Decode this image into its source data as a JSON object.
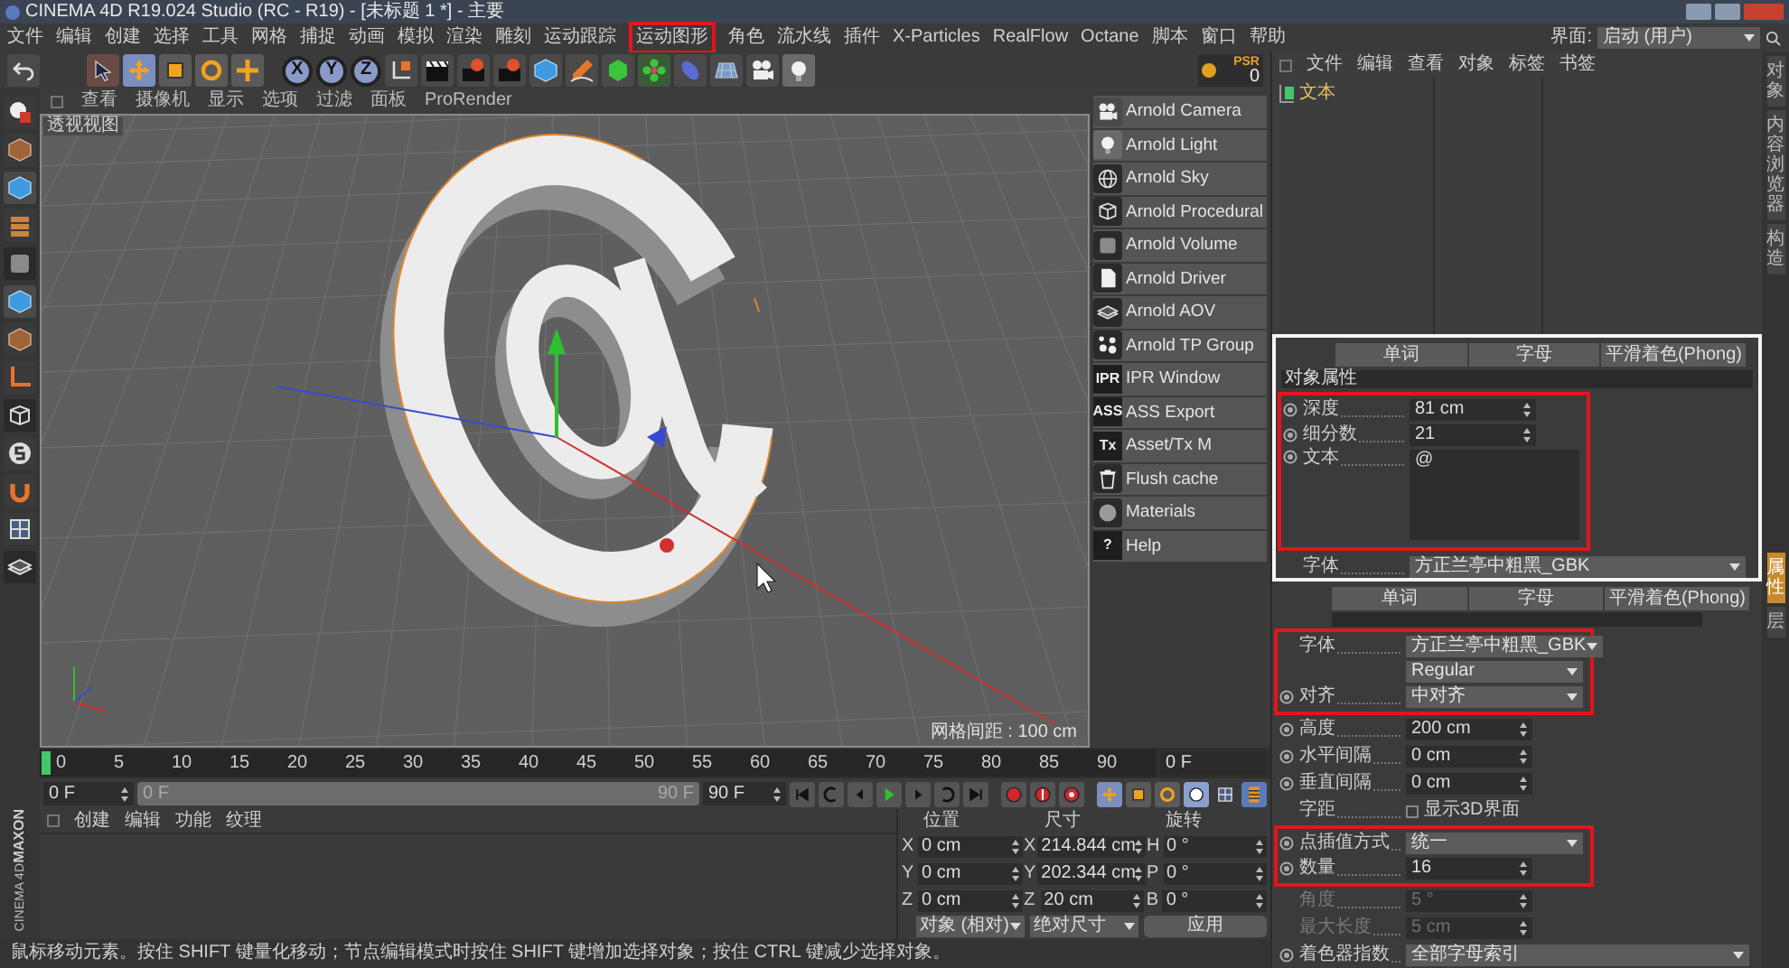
{
  "window": {
    "title": "CINEMA 4D R19.024 Studio (RC - R19) - [未标题 1 *] - 主要"
  },
  "menu": [
    {
      "label": "文件",
      "annotated": false
    },
    {
      "label": "编辑",
      "annotated": false
    },
    {
      "label": "创建",
      "annotated": false
    },
    {
      "label": "选择",
      "annotated": false
    },
    {
      "label": "工具",
      "annotated": false
    },
    {
      "label": "网格",
      "annotated": false
    },
    {
      "label": "捕捉",
      "annotated": false
    },
    {
      "label": "动画",
      "annotated": false
    },
    {
      "label": "模拟",
      "annotated": false
    },
    {
      "label": "渲染",
      "annotated": false
    },
    {
      "label": "雕刻",
      "annotated": false
    },
    {
      "label": "运动跟踪",
      "annotated": false
    },
    {
      "label": "运动图形",
      "annotated": true
    },
    {
      "label": "角色",
      "annotated": false
    },
    {
      "label": "流水线",
      "annotated": false
    },
    {
      "label": "插件",
      "annotated": false
    },
    {
      "label": "X-Particles",
      "annotated": false
    },
    {
      "label": "RealFlow",
      "annotated": false
    },
    {
      "label": "Octane",
      "annotated": false
    },
    {
      "label": "脚本",
      "annotated": false
    },
    {
      "label": "窗口",
      "annotated": false
    },
    {
      "label": "帮助",
      "annotated": false
    }
  ],
  "layout_switch": {
    "label": "界面:",
    "value": "启动 (用户)"
  },
  "toolbar": {
    "axis_buttons": [
      "X",
      "Y",
      "Z"
    ],
    "psr": {
      "label": "PSR",
      "value": "0"
    }
  },
  "viewport": {
    "menu": [
      "查看",
      "摄像机",
      "显示",
      "选项",
      "过滤",
      "面板",
      "ProRender"
    ],
    "view_label": "透视视图",
    "grid_info": "网格间距 : 100 cm"
  },
  "arnold_menu": [
    {
      "label": "Arnold Camera"
    },
    {
      "label": "Arnold Light"
    },
    {
      "label": "Arnold Sky"
    },
    {
      "label": "Arnold Procedural"
    },
    {
      "label": "Arnold Volume"
    },
    {
      "label": "Arnold Driver"
    },
    {
      "label": "Arnold AOV"
    },
    {
      "label": "Arnold TP Group"
    },
    {
      "label": "IPR Window",
      "badge": "IPR"
    },
    {
      "label": "ASS Export",
      "badge": "ASS"
    },
    {
      "label": "Asset/Tx M",
      "badge": "Tx"
    },
    {
      "label": "Flush cache"
    },
    {
      "label": "Materials"
    },
    {
      "label": "Help",
      "badge": "?"
    }
  ],
  "object_manager": {
    "menu": [
      "文件",
      "编辑",
      "查看",
      "对象",
      "标签",
      "书签"
    ],
    "objects": [
      {
        "name": "文本"
      }
    ]
  },
  "side_tabs_upper": [
    {
      "label": "对象",
      "selected": false
    },
    {
      "label": "内容浏览器",
      "selected": false
    },
    {
      "label": "构造",
      "selected": false
    }
  ],
  "side_tabs_lower": [
    {
      "label": "属性",
      "selected": true
    },
    {
      "label": "层",
      "selected": false
    }
  ],
  "inset": {
    "tabs": [
      "单词",
      "字母",
      "平滑着色(Phong)"
    ],
    "section": "对象属性",
    "fields": [
      {
        "kind": "number",
        "label": "深度",
        "value": "81 cm",
        "anim": true,
        "annotated": true,
        "disabled": false
      },
      {
        "kind": "number",
        "label": "细分数",
        "value": "21",
        "anim": true,
        "annotated": true,
        "disabled": false
      },
      {
        "kind": "textarea",
        "label": "文本",
        "value": "@",
        "anim": true,
        "annotated": true
      },
      {
        "kind": "dropdown",
        "label": "字体",
        "value": "方正兰亭中粗黑_GBK",
        "anim": false,
        "annotated": false
      }
    ]
  },
  "attributes": {
    "tabs": [
      "单词",
      "字母",
      "平滑着色(Phong)"
    ],
    "fields": [
      {
        "kind": "dropdown",
        "label": "字体",
        "value": "方正兰亭中粗黑_GBK",
        "anim": false,
        "annotated": true
      },
      {
        "kind": "dropdown",
        "value": "Regular",
        "anim": false,
        "annotated": true
      },
      {
        "kind": "dropdown",
        "label": "对齐",
        "value": "中对齐",
        "anim": true,
        "annotated": true
      },
      {
        "kind": "number",
        "label": "高度",
        "value": "200 cm",
        "anim": true,
        "annotated": false,
        "disabled": false
      },
      {
        "kind": "number",
        "label": "水平间隔",
        "value": "0 cm",
        "anim": true,
        "annotated": false,
        "disabled": false
      },
      {
        "kind": "number",
        "label": "垂直间隔",
        "value": "0 cm",
        "anim": true,
        "annotated": false,
        "disabled": false
      },
      {
        "kind": "checkbox",
        "label": "字距",
        "text": "显示3D界面",
        "checked": false,
        "anim": false,
        "annotated": false
      },
      {
        "kind": "dropdown",
        "label": "点插值方式",
        "value": "统一",
        "anim": true,
        "annotated": true
      },
      {
        "kind": "number",
        "label": "数量",
        "value": "16",
        "anim": true,
        "annotated": true,
        "disabled": false
      },
      {
        "kind": "number",
        "label": "角度",
        "value": "5 °",
        "anim": false,
        "annotated": false,
        "disabled": true
      },
      {
        "kind": "number",
        "label": "最大长度",
        "value": "5 cm",
        "anim": false,
        "annotated": false,
        "disabled": true
      },
      {
        "kind": "dropdown",
        "label": "着色器指数",
        "value": "全部字母索引",
        "anim": true,
        "annotated": false
      }
    ]
  },
  "timeline": {
    "ticks": [
      "0",
      "5",
      "10",
      "15",
      "20",
      "25",
      "30",
      "35",
      "40",
      "45",
      "50",
      "55",
      "60",
      "65",
      "70",
      "75",
      "80",
      "85",
      "90"
    ],
    "current_frame": "0 F"
  },
  "playback": {
    "start": "0 F",
    "range_start": "0 F",
    "range_end": "90 F",
    "level": 1,
    "end": "90 F"
  },
  "material_manager": {
    "menu": [
      "创建",
      "编辑",
      "功能",
      "纹理"
    ]
  },
  "coordinates": {
    "headers": [
      "位置",
      "尺寸",
      "旋转"
    ],
    "rows": [
      {
        "cells": [
          {
            "axis": "X",
            "value": "0 cm"
          },
          {
            "axis": "X",
            "value": "214.844 cm"
          },
          {
            "axis": "H",
            "value": "0 °"
          }
        ]
      },
      {
        "cells": [
          {
            "axis": "Y",
            "value": "0 cm"
          },
          {
            "axis": "Y",
            "value": "202.344 cm"
          },
          {
            "axis": "P",
            "value": "0 °"
          }
        ]
      },
      {
        "cells": [
          {
            "axis": "Z",
            "value": "0 cm"
          },
          {
            "axis": "Z",
            "value": "20 cm"
          },
          {
            "axis": "B",
            "value": "0 °"
          }
        ]
      }
    ],
    "mode": "对象 (相对)",
    "size_mode": "绝对尺寸",
    "apply": "应用"
  },
  "logo": {
    "brand": "MAXON",
    "product": "CINEMA 4D"
  },
  "status_bar": {
    "text": "鼠标移动元素。按住 SHIFT 键量化移动；节点编辑模式时按住 SHIFT 键增加选择对象；按住 CTRL 键减少选择对象。"
  }
}
